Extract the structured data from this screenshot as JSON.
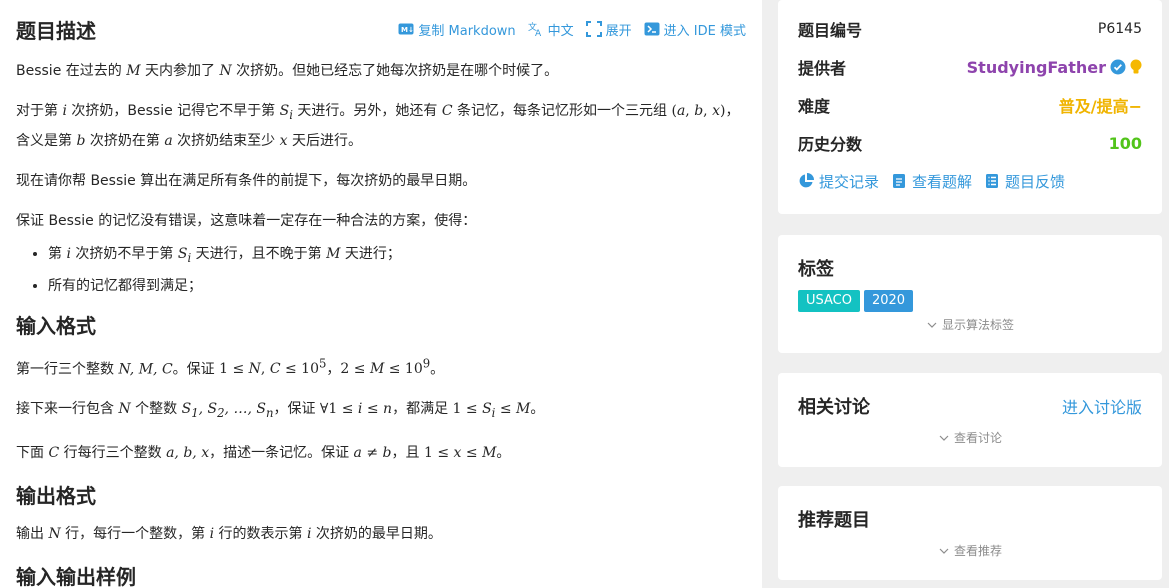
{
  "main": {
    "title": "题目描述",
    "toolbar": {
      "copy_markdown": "复制 Markdown",
      "language": "中文",
      "expand": "展开",
      "ide_mode": "进入 IDE 模式"
    },
    "desc": {
      "p1a": "Bessie 在过去的 ",
      "p1b": " 天内参加了 ",
      "p1c": " 次挤奶。但她已经忘了她每次挤奶是在哪个时候了。",
      "p2a": "对于第 ",
      "p2b": " 次挤奶，Bessie 记得它不早于第 ",
      "p2c": " 天进行。另外，她还有 ",
      "p2d": " 条记忆，每条记忆形如一个三元组 ",
      "p2e": "，含义是第 ",
      "p2f": " 次挤奶在第 ",
      "p2g": " 次挤奶结束至少 ",
      "p2h": " 天后进行。",
      "p3": "现在请你帮 Bessie 算出在满足所有条件的前提下，每次挤奶的最早日期。",
      "p4": "保证 Bessie 的记忆没有错误，这意味着一定存在一种合法的方案，使得：",
      "li1a": "第 ",
      "li1b": " 次挤奶不早于第 ",
      "li1c": " 天进行，且不晚于第 ",
      "li1d": " 天进行；",
      "li2": "所有的记忆都得到满足；"
    },
    "input_title": "输入格式",
    "input": {
      "l1a": "第一行三个整数 ",
      "l1b": "。保证 ",
      "l1c": "，",
      "l1d": "。",
      "l2a": "接下来一行包含 ",
      "l2b": " 个整数 ",
      "l2c": "，保证 ",
      "l2d": "，都满足 ",
      "l2e": "。",
      "l3a": "下面 ",
      "l3b": " 行每行三个整数 ",
      "l3c": "，描述一条记忆。保证 ",
      "l3d": "，且 ",
      "l3e": "。"
    },
    "output_title": "输出格式",
    "output": {
      "a": "输出 ",
      "b": " 行，每行一个整数，第 ",
      "c": " 行的数表示第 ",
      "d": " 次挤奶的最早日期。"
    },
    "sample_title": "输入输出样例"
  },
  "info": {
    "problem_id_label": "题目编号",
    "problem_id": "P6145",
    "provider_label": "提供者",
    "provider": "StudyingFather",
    "difficulty_label": "难度",
    "difficulty": "普及/提高−",
    "score_label": "历史分数",
    "score": "100",
    "submit_record": "提交记录",
    "view_solution": "查看题解",
    "feedback": "题目反馈"
  },
  "tags": {
    "title": "标签",
    "items": [
      "USACO",
      "2020"
    ],
    "show_algo": "显示算法标签"
  },
  "discuss": {
    "title": "相关讨论",
    "enter": "进入讨论版",
    "view": "查看讨论"
  },
  "recommend": {
    "title": "推荐题目",
    "view": "查看推荐"
  },
  "colors": {
    "accent": "#3498db",
    "provider": "#8e44ad",
    "difficulty": "#f0b400",
    "score": "#52c41a",
    "tag_usaco": "#13c2c2",
    "tag_year": "#3498db"
  },
  "icons": {
    "markdown": "markdown-icon",
    "translate": "translate-icon",
    "expand": "expand-icon",
    "ide": "terminal-icon",
    "verified": "verified-badge-icon",
    "bulb": "lightbulb-icon",
    "chart": "pie-chart-icon",
    "solution": "book-icon",
    "feedback": "list-icon",
    "chevron": "chevron-down-icon"
  }
}
